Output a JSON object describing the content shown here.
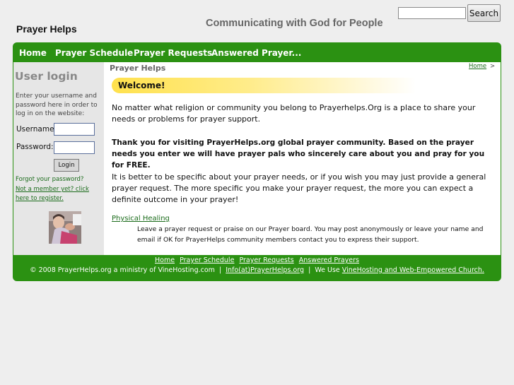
{
  "header": {
    "site_name": "Prayer Helps",
    "tagline": "Communicating with God for People",
    "search_button_label": "Search",
    "search_value": ""
  },
  "nav": {
    "items": [
      {
        "label": "Home"
      },
      {
        "label": "Prayer Schedule"
      },
      {
        "label": "Prayer Requests"
      },
      {
        "label": "Answered Prayer..."
      }
    ]
  },
  "sidebar": {
    "title": "User login",
    "help_text": "Enter your username and password here in order to log in on the website:",
    "username_label": "Username:",
    "username_value": "",
    "password_label": "Password:",
    "password_value": "",
    "login_button_label": "Login",
    "forgot_link": "Forgot your password?",
    "register_link": "Not a member yet? click here to register."
  },
  "main": {
    "page_title": "Prayer Helps",
    "breadcrumb_home": "Home",
    "breadcrumb_sep": ">",
    "welcome": "Welcome!",
    "para1": "No matter what religion or community you belong to Prayerhelps.Org is a place to share your needs or problems for prayer support.",
    "para2": "Thank you for visiting PrayerHelps.org global prayer community. Based on the prayer needs you enter we will have prayer pals who sincerely care about you and pray for you for FREE.",
    "para3": "It is better to be specific about your prayer needs, or if you wish you may just provide a general prayer request. The more specific you make your prayer request, the more you can expect a definite outcome in your prayer!",
    "physical_healing_link": "Physical Healing",
    "physical_healing_desc": "Leave a prayer request or praise on our Prayer board. You may post anonymously or leave your name and email if OK for PrayerHelps community members contact you to express their support."
  },
  "footer": {
    "links": [
      {
        "label": "Home"
      },
      {
        "label": "Prayer Schedule"
      },
      {
        "label": "Prayer Requests"
      },
      {
        "label": "Answered Prayers"
      }
    ],
    "copyright": "© 2008 PrayerHelps.org a ministry of VineHosting.com",
    "sep1": "|",
    "email_link": "Info(at)PrayerHelps.org",
    "sep2": "|",
    "we_use": "We Use",
    "vine_link": "VineHosting and Web-Empowered Church."
  },
  "colors": {
    "accent_green": "#2b9112",
    "link_green": "#1a6b1a",
    "welcome_yellow": "#ffe14d",
    "sidebar_gray": "#e6e6e6"
  }
}
